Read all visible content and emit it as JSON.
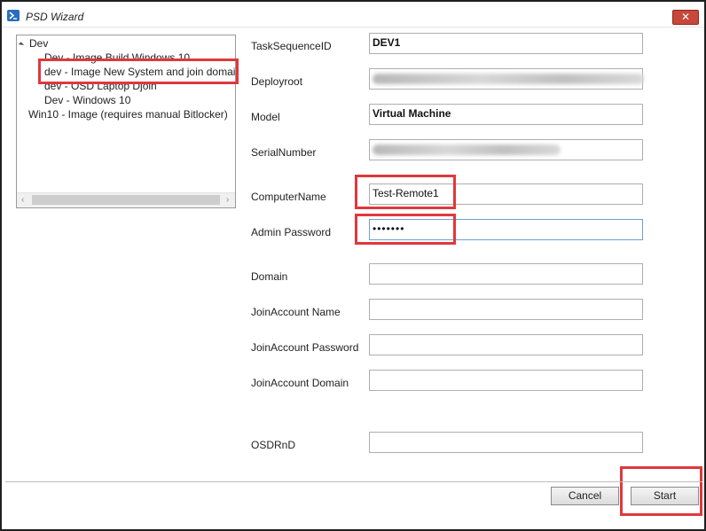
{
  "window": {
    "title": "PSD Wizard",
    "close_label": "✕"
  },
  "tree": {
    "nodes": [
      {
        "label": "Dev",
        "level": 0
      },
      {
        "label": "Dev - Image Build Windows 10",
        "level": 1
      },
      {
        "label": "dev - Image New System and join domain",
        "level": 1,
        "selected": true
      },
      {
        "label": "dev - OSD Laptop Djoin",
        "level": 1
      },
      {
        "label": "Dev - Windows 10",
        "level": 1
      },
      {
        "label": "Win10 - Image (requires manual Bitlocker)",
        "level": 0
      }
    ],
    "scroll_left": "‹",
    "scroll_right": "›"
  },
  "form": {
    "task_sequence_id": {
      "label": "TaskSequenceID",
      "value": "DEV1"
    },
    "deployroot": {
      "label": "Deployroot",
      "value": ""
    },
    "model": {
      "label": "Model",
      "value": "Virtual Machine"
    },
    "serial_number": {
      "label": "SerialNumber",
      "value": ""
    },
    "computer_name": {
      "label": "ComputerName",
      "value": "Test-Remote1"
    },
    "admin_password": {
      "label": "Admin Password",
      "value": "•••••••"
    },
    "domain": {
      "label": "Domain",
      "value": ""
    },
    "join_account_name": {
      "label": "JoinAccount Name",
      "value": ""
    },
    "join_account_password": {
      "label": "JoinAccount Password",
      "value": ""
    },
    "join_account_domain": {
      "label": "JoinAccount Domain",
      "value": ""
    },
    "osdrnd": {
      "label": "OSDRnD",
      "value": ""
    }
  },
  "buttons": {
    "cancel": "Cancel",
    "start": "Start"
  },
  "colors": {
    "highlight": "#e0383c",
    "close": "#c8463a",
    "focus": "#6f9fd1"
  }
}
